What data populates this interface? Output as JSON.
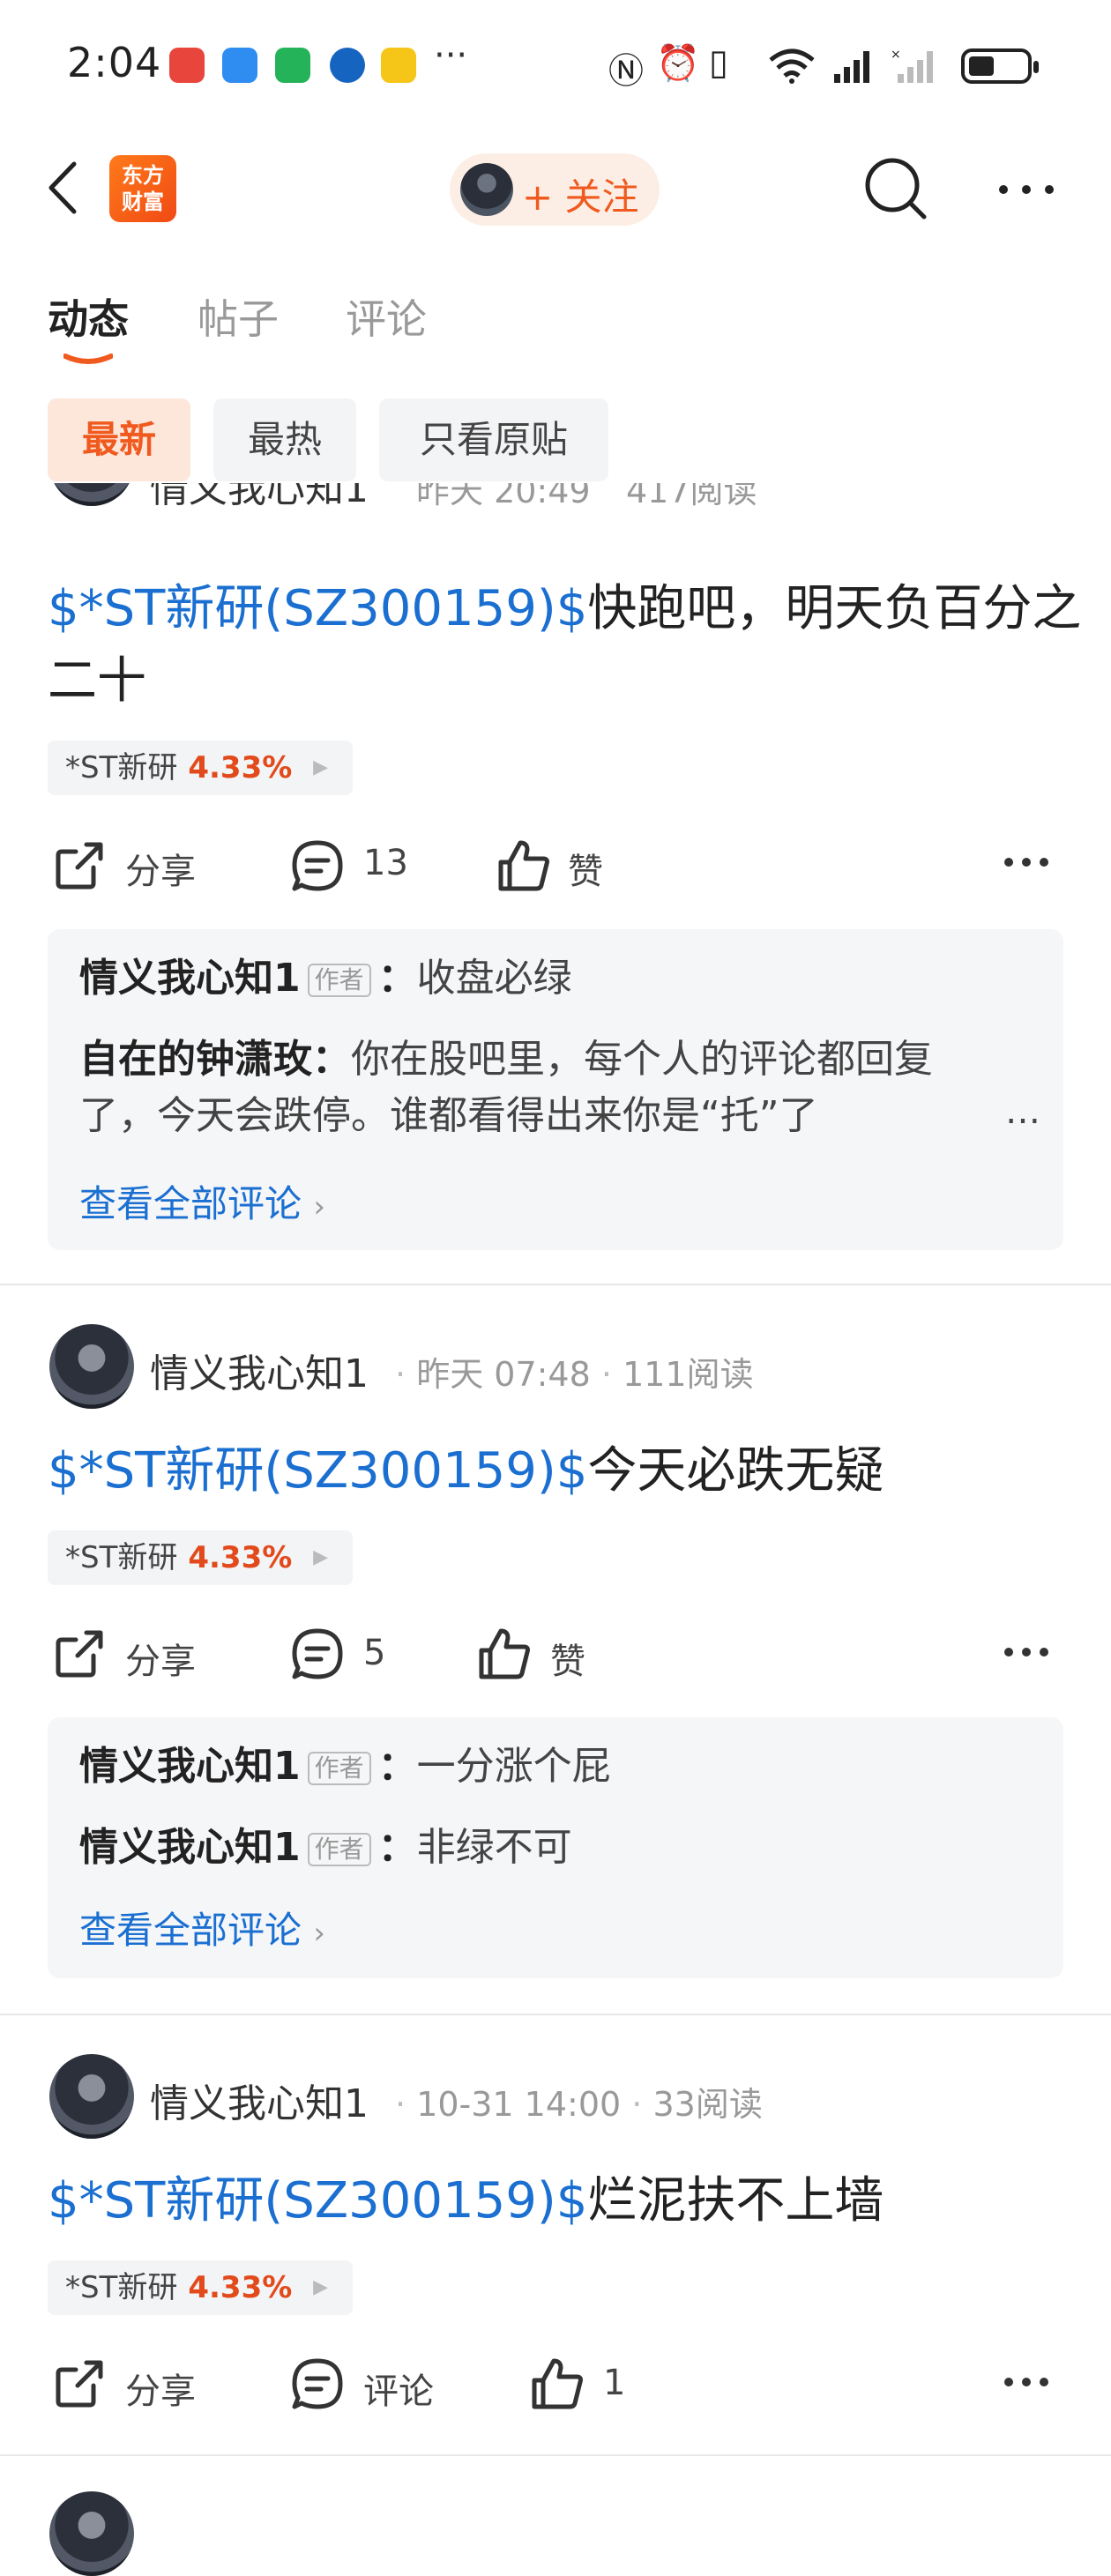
{
  "status_bar": {
    "time": "2:04",
    "overflow": "···"
  },
  "nav": {
    "logo_text": "东方财富",
    "logo_line1": "东方",
    "logo_line2": "财富",
    "follow_label": "+ 关注"
  },
  "tabs": [
    {
      "label": "动态"
    },
    {
      "label": "帖子"
    },
    {
      "label": "评论"
    }
  ],
  "filters": [
    {
      "label": "最新"
    },
    {
      "label": "最热"
    },
    {
      "label": "只看原贴"
    }
  ],
  "posts": [
    {
      "author": "情义我心知1",
      "time": "昨天 20:49",
      "reads": "417阅读",
      "stock_link": "$*ST新研(SZ300159)$",
      "text": "快跑吧，明天负百分之二十",
      "stock_name": "*ST新研",
      "stock_change": "4.33%",
      "share": "分享",
      "comments": "13",
      "likes": "赞",
      "comment_preview": [
        {
          "user": "情义我心知1",
          "is_author": true,
          "text": "收盘必绿"
        },
        {
          "user": "自在的钟潇玫",
          "is_author": false,
          "text": "你在股吧里，每个人的评论都回复了，今天会跌停。谁都看得出来你是“托”了"
        }
      ],
      "view_all": "查看全部评论"
    },
    {
      "author": "情义我心知1",
      "time": "昨天 07:48",
      "reads": "111阅读",
      "stock_link": "$*ST新研(SZ300159)$",
      "text": "今天必跌无疑",
      "stock_name": "*ST新研",
      "stock_change": "4.33%",
      "share": "分享",
      "comments": "5",
      "likes": "赞",
      "comment_preview": [
        {
          "user": "情义我心知1",
          "is_author": true,
          "text": "一分涨个屁"
        },
        {
          "user": "情义我心知1",
          "is_author": true,
          "text": "非绿不可"
        }
      ],
      "view_all": "查看全部评论"
    },
    {
      "author": "情义我心知1",
      "time": "10-31 14:00",
      "reads": "33阅读",
      "stock_link": "$*ST新研(SZ300159)$",
      "text": "烂泥扶不上墙",
      "stock_name": "*ST新研",
      "stock_change": "4.33%",
      "share": "分享",
      "comments": "评论",
      "likes": "1"
    }
  ],
  "labels": {
    "author_tag": "作者",
    "ellipsis": "…",
    "colon": "："
  },
  "colors": {
    "accent": "#f05a1e",
    "link": "#1a6fd1",
    "rise": "#e24a1c"
  }
}
